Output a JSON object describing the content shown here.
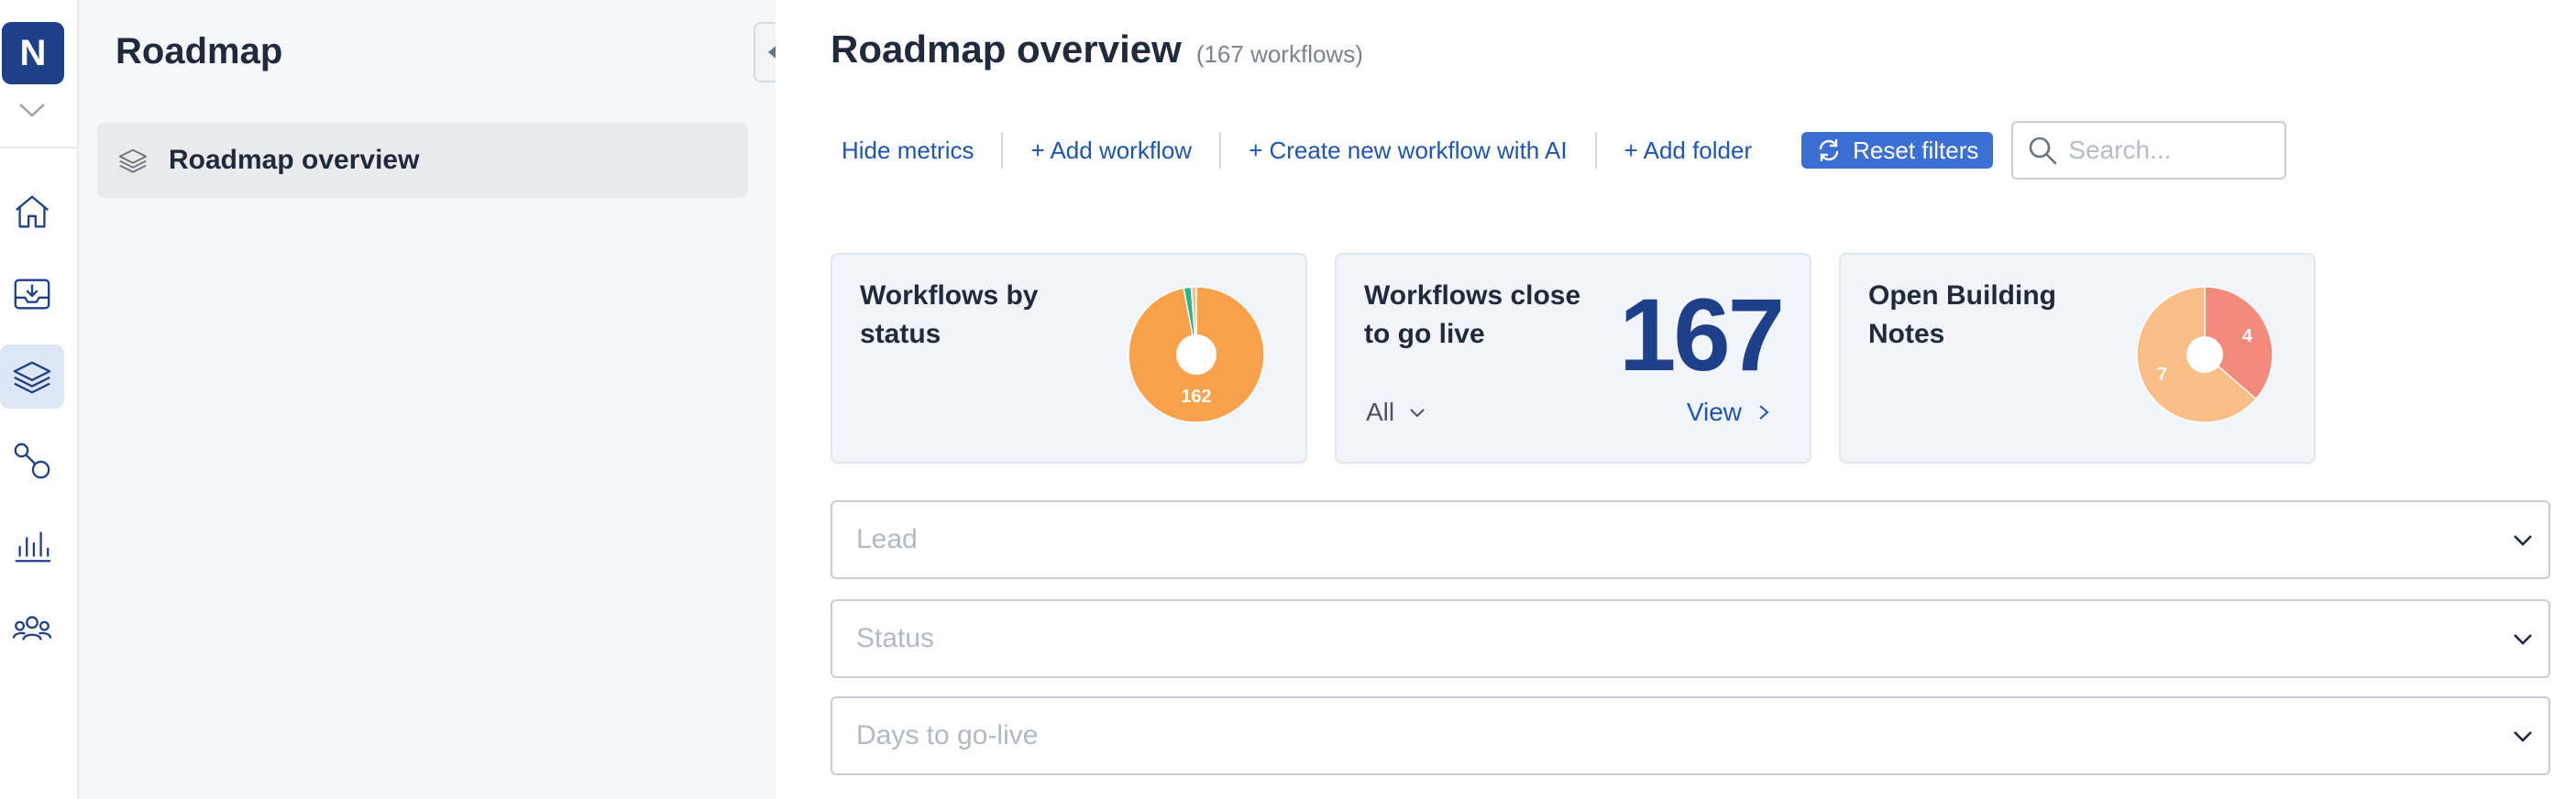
{
  "rail": {
    "logo_letter": "N",
    "items": [
      {
        "icon": "home-icon"
      },
      {
        "icon": "inbox-icon"
      },
      {
        "icon": "layers-icon",
        "active": true
      },
      {
        "icon": "workflow-icon"
      },
      {
        "icon": "analytics-icon"
      },
      {
        "icon": "team-icon"
      }
    ]
  },
  "sidebar": {
    "title": "Roadmap",
    "items": [
      {
        "label": "Roadmap overview",
        "icon": "layers-icon",
        "active": true
      }
    ]
  },
  "main": {
    "title": "Roadmap overview",
    "count": "(167 workflows)",
    "toolbar": {
      "hide_metrics": "Hide metrics",
      "add_workflow": "+ Add workflow",
      "create_ai": "+ Create new workflow with AI",
      "add_folder": "+ Add folder",
      "reset_filters": "Reset filters",
      "search_placeholder": "Search..."
    },
    "cards": {
      "status": {
        "title": "Workflows by status",
        "pie_label": "162",
        "slices": [
          {
            "value": 162,
            "color": "#f9a04a"
          },
          {
            "value": 3,
            "color": "#2bb38e"
          },
          {
            "value": 2,
            "color": "#f5c08a"
          }
        ]
      },
      "golive": {
        "title": "Workflows close to go live",
        "value": "167",
        "filter": "All",
        "view": "View"
      },
      "notes": {
        "title": "Open Building Notes",
        "slices": [
          {
            "value": 4,
            "label": "4",
            "color": "#f28b7c"
          },
          {
            "value": 7,
            "label": "7",
            "color": "#f9bd86"
          }
        ]
      }
    },
    "filters": {
      "lead": "Lead",
      "status": "Status",
      "days": "Days to go-live"
    }
  },
  "colors": {
    "brand": "#1e3f8a",
    "link": "#1e54b7",
    "reset_button": "#3b6fd4"
  }
}
